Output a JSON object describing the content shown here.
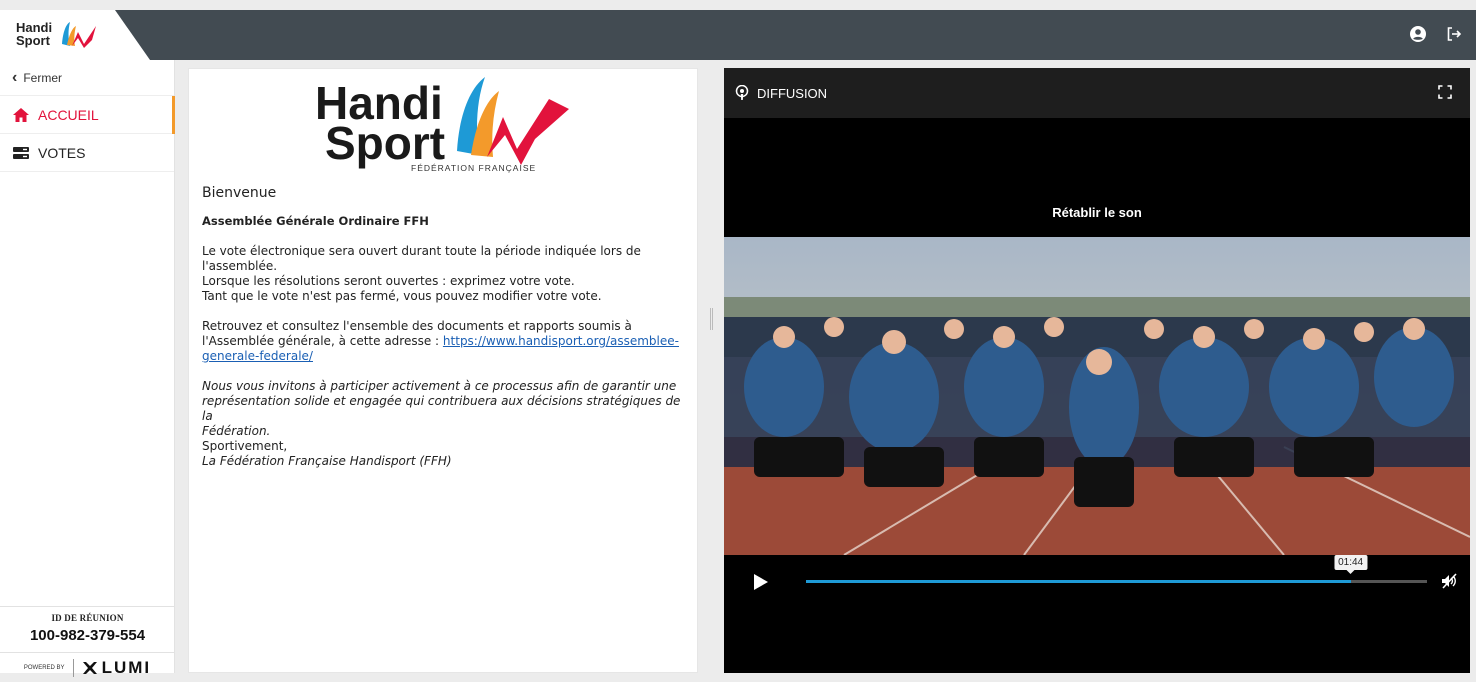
{
  "topbar": {
    "logo_line1": "Handi",
    "logo_line2": "Sport"
  },
  "sidebar": {
    "close_label": "Fermer",
    "items": [
      {
        "label": "ACCUEIL",
        "icon": "home-icon",
        "active": true
      },
      {
        "label": "VOTES",
        "icon": "votes-icon",
        "active": false
      }
    ],
    "meeting_id_label": "ID DE RÉUNION",
    "meeting_id": "100-982-379-554",
    "powered_by": "POWERED BY",
    "brand": "LUMI"
  },
  "welcome": {
    "logo_line1": "Handi",
    "logo_line2": "Sport",
    "logo_sub": "FÉDÉRATION FRANÇAISE",
    "heading": "Bienvenue",
    "title": "Assemblée Générale Ordinaire FFH",
    "p1_l1": "Le vote électronique sera ouvert durant toute la période indiquée lors de",
    "p1_l2": "l'assemblée.",
    "p1_l3": "Lorsque les résolutions seront ouvertes : exprimez votre vote.",
    "p1_l4": "Tant que le vote n'est pas fermé, vous pouvez modifier votre vote.",
    "p2_l1": "Retrouvez et consultez l'ensemble des documents et rapports soumis à",
    "p2_l2": "l'Assemblée générale, à cette adresse : ",
    "p2_link_a": "https://www.handisport.org/assemblee-",
    "p2_link_b": "generale-federale/",
    "p3_l1": "Nous vous invitons à participer activement à ce processus afin de garantir une",
    "p3_l2": "représentation solide et engagée qui contribuera aux décisions stratégiques de la",
    "p3_l3": "Fédération.",
    "p3_l4": "Sportivement,",
    "p3_l5": "La Fédération Française Handisport (FFH)"
  },
  "broadcast": {
    "title": "DIFFUSION",
    "unmute_label": "Rétablir le son",
    "time": "01:44",
    "progress": 0.877
  },
  "colors": {
    "topbar": "#424b52",
    "accent_red": "#e2133c",
    "accent_orange": "#f39a2b",
    "progress_blue": "#1e9ad6"
  }
}
